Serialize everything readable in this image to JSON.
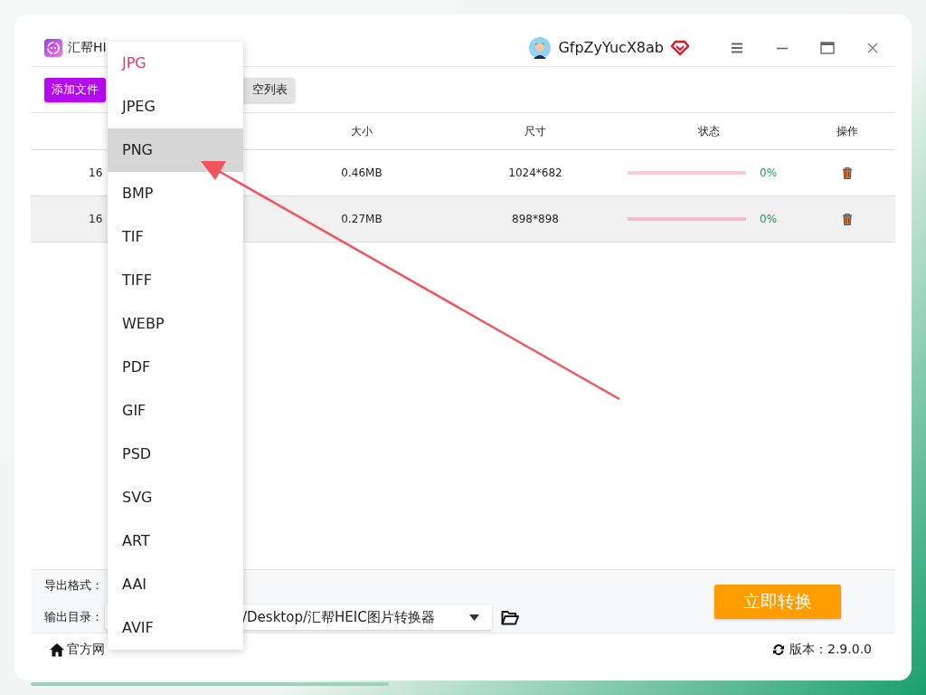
{
  "app": {
    "title": "汇帮HI"
  },
  "user": {
    "name": "GfpZyYucX8ab"
  },
  "toolbar": {
    "buttons": [
      {
        "label": "添加文件",
        "kind": "primary"
      },
      {
        "label": "空列表",
        "kind": "secondary"
      }
    ]
  },
  "table": {
    "columns": [
      "大小",
      "尺寸",
      "状态",
      "操作"
    ],
    "rows": [
      {
        "name": "16",
        "size": "0.46MB",
        "dimensions": "1024*682",
        "level": 0,
        "percent": "0%"
      },
      {
        "name": "16",
        "size": "0.27MB",
        "dimensions": "898*898",
        "level": 0,
        "percent": "0%"
      }
    ]
  },
  "format_menu": {
    "items": [
      {
        "label": "JPG",
        "selected": true,
        "highlighted": false
      },
      {
        "label": "JPEG",
        "selected": false,
        "highlighted": false
      },
      {
        "label": "PNG",
        "selected": false,
        "highlighted": true
      },
      {
        "label": "BMP",
        "selected": false,
        "highlighted": false
      },
      {
        "label": "TIF",
        "selected": false,
        "highlighted": false
      },
      {
        "label": "TIFF",
        "selected": false,
        "highlighted": false
      },
      {
        "label": "WEBP",
        "selected": false,
        "highlighted": false
      },
      {
        "label": "PDF",
        "selected": false,
        "highlighted": false
      },
      {
        "label": "GIF",
        "selected": false,
        "highlighted": false
      },
      {
        "label": "PSD",
        "selected": false,
        "highlighted": false
      },
      {
        "label": "SVG",
        "selected": false,
        "highlighted": false
      },
      {
        "label": "ART",
        "selected": false,
        "highlighted": false
      },
      {
        "label": "AAI",
        "selected": false,
        "highlighted": false
      },
      {
        "label": "AVIF",
        "selected": false,
        "highlighted": false
      }
    ]
  },
  "settings": {
    "format_label": "导出格式：",
    "output_label": "输出目录：",
    "output_path": "/Desktop/汇帮HEIC图片转换器"
  },
  "convert_button": "立即转换",
  "footer": {
    "link": "官方网",
    "version": "版本：2.9.0.0"
  }
}
